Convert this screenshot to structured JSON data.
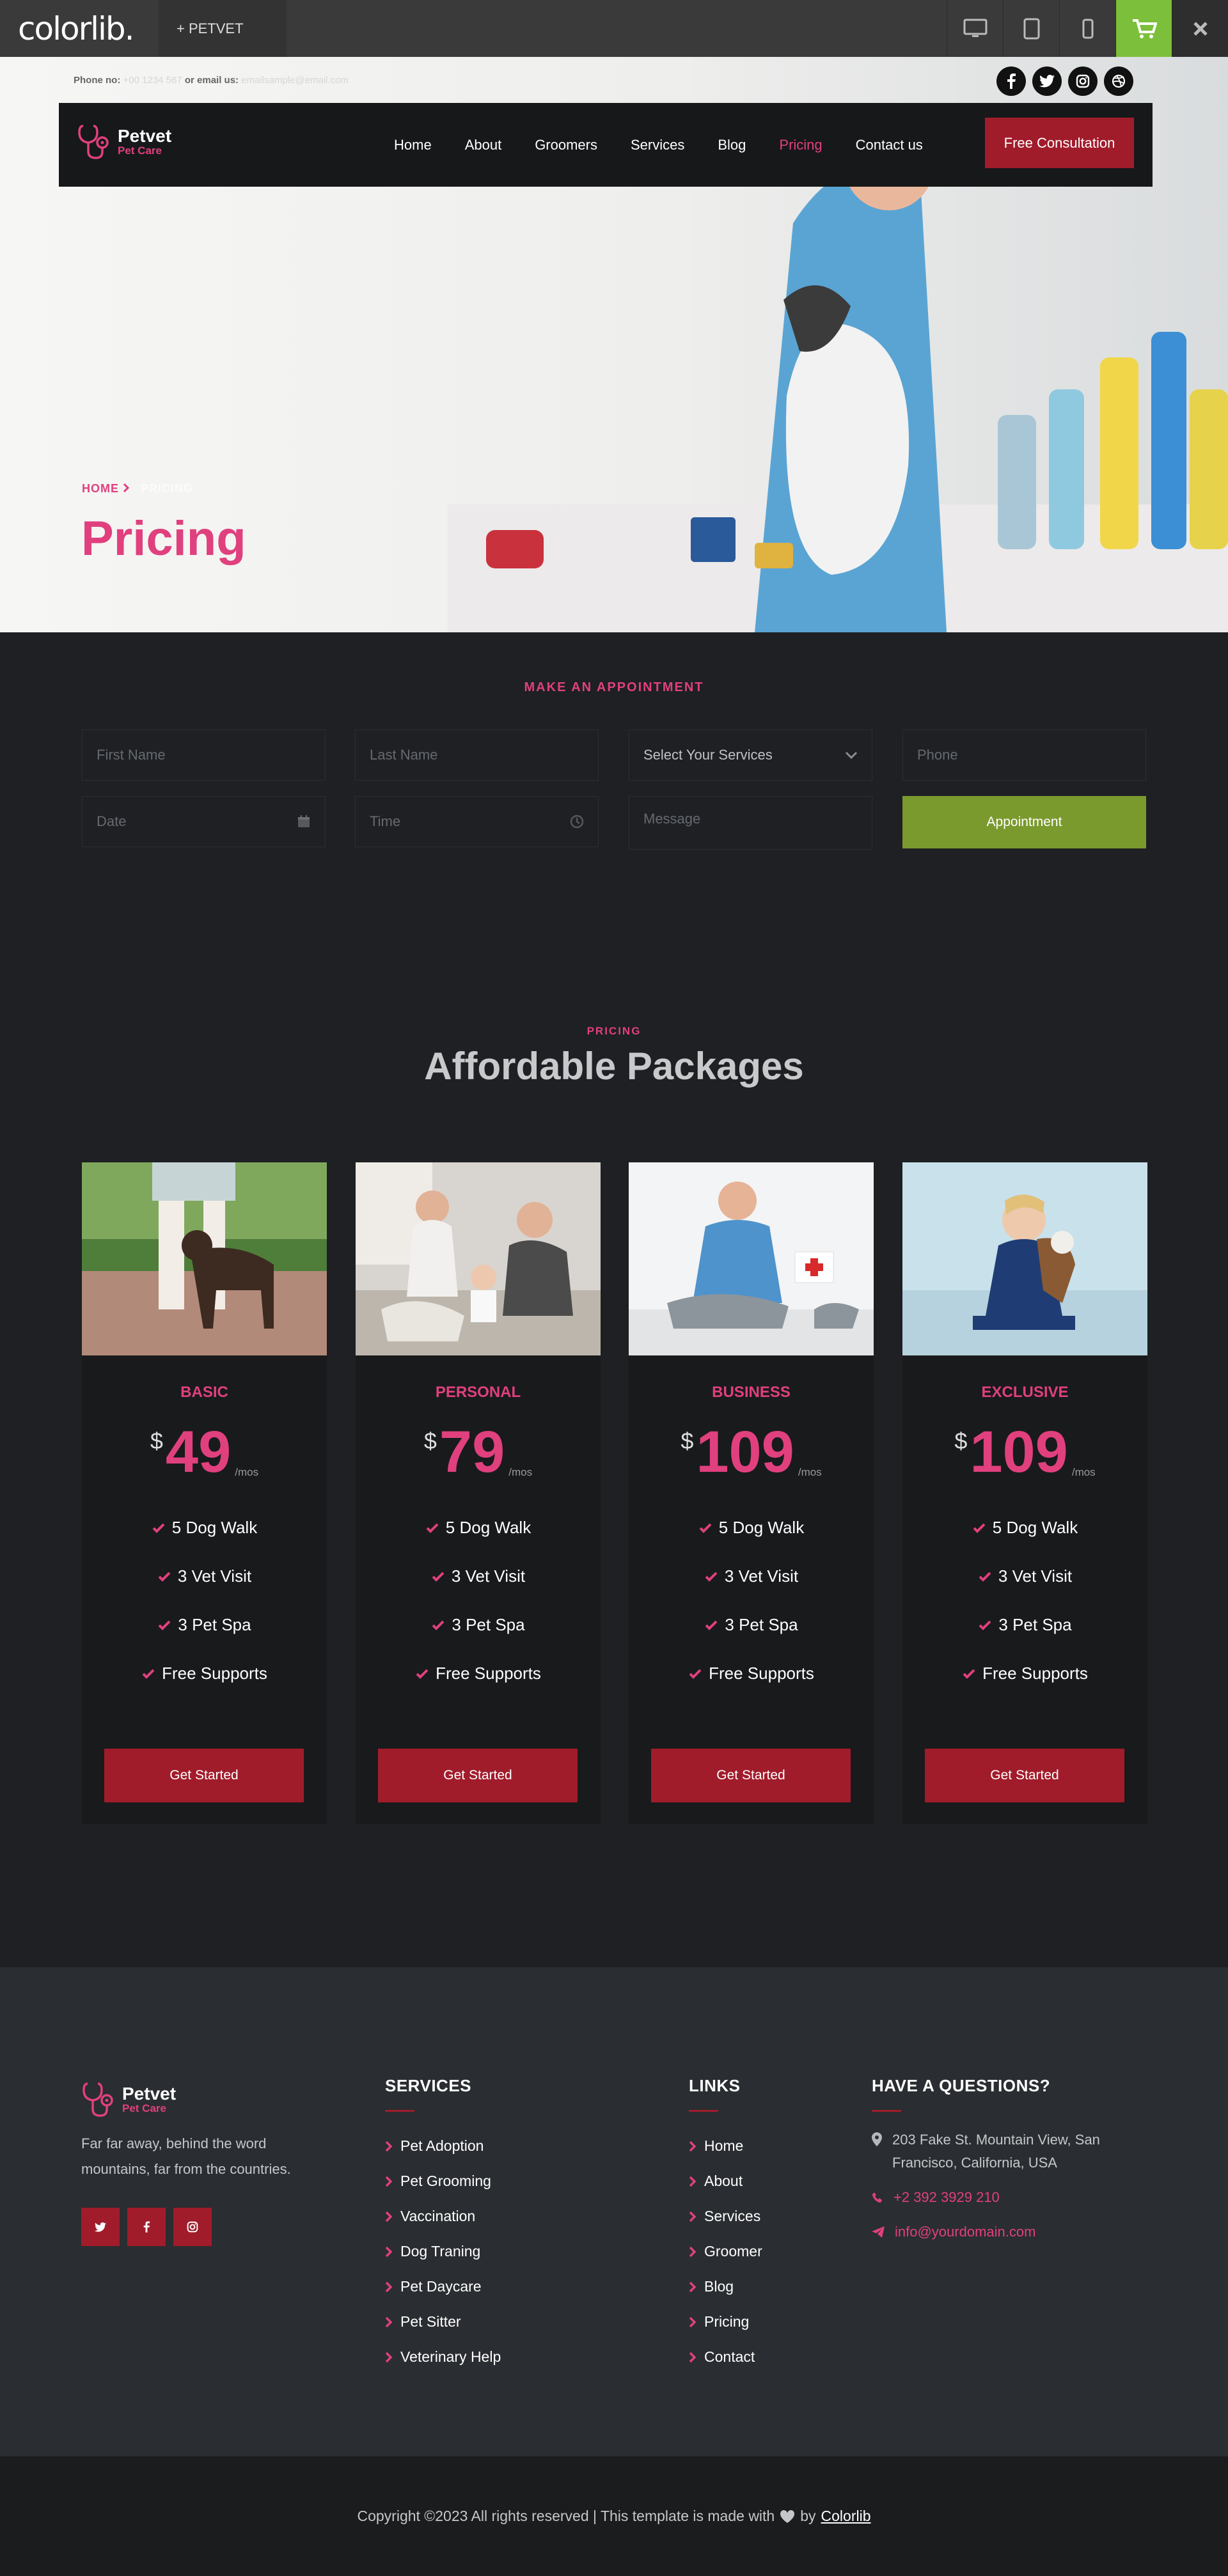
{
  "topbar": {
    "brand": "colorlib.",
    "tab_label": "+  PETVET",
    "devices": [
      "desktop-icon",
      "tablet-icon",
      "mobile-icon",
      "cart-icon",
      "close-icon"
    ],
    "accent": "#7cbf3a"
  },
  "header": {
    "phone_label": "Phone no:",
    "phone_value": "+00 1234 567",
    "email_label": "or email us:",
    "email_value": "emailsample@email.com",
    "socials": [
      "facebook-icon",
      "twitter-icon",
      "instagram-icon",
      "dribbble-icon"
    ]
  },
  "nav": {
    "logo_name": "Petvet",
    "logo_sub": "Pet Care",
    "items": [
      "Home",
      "About",
      "Groomers",
      "Services",
      "Blog",
      "Pricing",
      "Contact us"
    ],
    "active": "Pricing",
    "cta": "Free Consultation"
  },
  "hero": {
    "breadcrumb_home": "HOME",
    "breadcrumb_current": "PRICING",
    "title": "Pricing"
  },
  "appointment": {
    "heading": "MAKE AN APPOINTMENT",
    "first_name": "First Name",
    "last_name": "Last Name",
    "service": "Select Your Services",
    "phone": "Phone",
    "date": "Date",
    "time": "Time",
    "message": "Message",
    "button": "Appointment"
  },
  "pricing": {
    "subtitle": "PRICING",
    "title": "Affordable Packages",
    "currency": "$",
    "period": "/mos",
    "button": "Get Started",
    "plans": [
      {
        "name": "BASIC",
        "price": "49",
        "features": [
          "5 Dog Walk",
          "3 Vet Visit",
          "3 Pet Spa",
          "Free Supports"
        ]
      },
      {
        "name": "PERSONAL",
        "price": "79",
        "features": [
          "5 Dog Walk",
          "3 Vet Visit",
          "3 Pet Spa",
          "Free Supports"
        ]
      },
      {
        "name": "BUSINESS",
        "price": "109",
        "features": [
          "5 Dog Walk",
          "3 Vet Visit",
          "3 Pet Spa",
          "Free Supports"
        ]
      },
      {
        "name": "EXCLUSIVE",
        "price": "109",
        "features": [
          "5 Dog Walk",
          "3 Vet Visit",
          "3 Pet Spa",
          "Free Supports"
        ]
      }
    ]
  },
  "footer": {
    "about_text": "Far far away, behind the word mountains, far from the countries.",
    "services_title": "SERVICES",
    "services": [
      "Pet Adoption",
      "Pet Grooming",
      "Vaccination",
      "Dog Traning",
      "Pet Daycare",
      "Pet Sitter",
      "Veterinary Help"
    ],
    "links_title": "LINKS",
    "links": [
      "Home",
      "About",
      "Services",
      "Groomer",
      "Blog",
      "Pricing",
      "Contact"
    ],
    "questions_title": "HAVE A QUESTIONS?",
    "address": "203 Fake St. Mountain View, San Francisco, California, USA",
    "phone": "+2 392 3929 210",
    "email": "info@yourdomain.com",
    "copyright": "Copyright ©2023 All rights reserved | This template is made with",
    "by": "by",
    "credit": "Colorlib"
  },
  "colors": {
    "accent_pink": "#e0407e",
    "brand_red": "#a11c2b",
    "appointment_green": "#7a9a2e"
  }
}
